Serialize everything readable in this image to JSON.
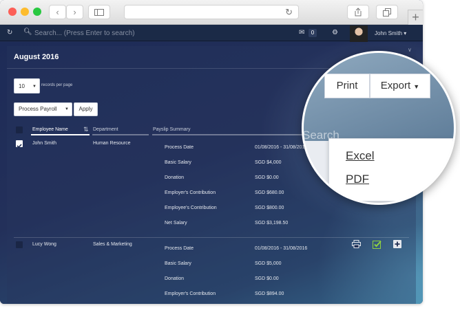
{
  "browser": {
    "colors": {
      "close": "#fc5f57",
      "minimize": "#fdbc2e",
      "maximize": "#28c840"
    }
  },
  "topbar": {
    "search_placeholder": "Search... (Press Enter to search)",
    "mail_count": "0",
    "user_name": "John Smith"
  },
  "page": {
    "title": "August 2016",
    "records_value": "10",
    "records_label": "records per page",
    "bulk_action": "Process Payroll",
    "apply_label": "Apply"
  },
  "table": {
    "headers": {
      "name": "Employee Name",
      "department": "Department",
      "summary": "Payslip Summary"
    },
    "rows": [
      {
        "name": "John Smith",
        "department": "Human Resource",
        "checked": true,
        "items": [
          {
            "label": "Process Date",
            "value": "01/08/2016 - 31/08/2016"
          },
          {
            "label": "Basic Salary",
            "value": "SGD $4,000"
          },
          {
            "label": "Donation",
            "value": "SGD $0.00"
          },
          {
            "label": "Employer's Contribution",
            "value": "SGD $680.00"
          },
          {
            "label": "Employee's Contribution",
            "value": "SGD $800.00"
          },
          {
            "label": "Net Salary",
            "value": "SGD $3,198.50"
          }
        ]
      },
      {
        "name": "Lucy Wong",
        "department": "Sales & Marketing",
        "checked": false,
        "items": [
          {
            "label": "Process Date",
            "value": "01/08/2016 - 31/08/2016"
          },
          {
            "label": "Basic Salary",
            "value": "SGD $5,000"
          },
          {
            "label": "Donation",
            "value": "SGD $0.00"
          },
          {
            "label": "Employer's Contribution",
            "value": "SGD $894.00"
          }
        ]
      }
    ],
    "row_actions": [
      "print-icon",
      "approve-check-icon",
      "add-icon"
    ]
  },
  "magnifier": {
    "print_label": "Print",
    "export_label": "Export",
    "search_ghost": "Search",
    "export_options": [
      "Excel",
      "PDF"
    ]
  },
  "colors": {
    "accent_check": "#8fd13f",
    "header_underline": "#ffffff"
  }
}
